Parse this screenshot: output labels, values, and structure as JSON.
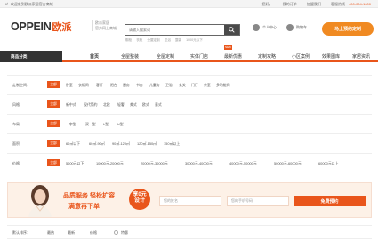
{
  "topbar": {
    "welcome": "Hi！欢迎来到欧派家居官方商城",
    "login": "您好，",
    "myorder": "我的订单",
    "join": "加盟我们",
    "hotline_label": "客服热线",
    "hotline": "400-004-1000"
  },
  "header": {
    "logo_en": "OPPEIN",
    "logo_cn": "欧派",
    "sub1": "欧派家居",
    "sub2": "官方网上商城",
    "search_placeholder": "请输入搜索词",
    "hotwords": [
      "橱柜",
      "衣柜",
      "全屋定制",
      "卫浴",
      "整装",
      "1000元以下"
    ],
    "user_label": "个人中心",
    "cart_label": "购物车",
    "book_button": "马上预约定制"
  },
  "nav": {
    "category": "商品分类",
    "items": [
      "首页",
      "全屋整装",
      "全屋定制",
      "实体门店",
      "最新优惠",
      "定制攻略",
      "小区案例",
      "效果图库",
      "家居资讯"
    ],
    "new_badge": "NEW"
  },
  "filters": [
    {
      "label": "定制空间：",
      "all": "全部",
      "options": [
        "卧室",
        "衣帽间",
        "客厅",
        "阳台",
        "厨房",
        "书房",
        "儿童房",
        "卫浴",
        "玄关",
        "门厅",
        "茶室",
        "多功能间"
      ]
    },
    {
      "label": "风格",
      "all": "全部",
      "options": [
        "新中式",
        "现代简约",
        "北欧",
        "轻奢",
        "美式",
        "欧式",
        "意式"
      ]
    },
    {
      "label": "布局",
      "all": "全部",
      "options": [
        "一字型",
        "双一型",
        "L型",
        "U型"
      ]
    },
    {
      "label": "面积",
      "all": "全部",
      "options": [
        "60㎡以下",
        "60㎡-90㎡",
        "90㎡-120㎡",
        "120㎡-150㎡",
        "150㎡以上"
      ]
    },
    {
      "label": "价格",
      "all": "全部",
      "options": [
        "5000元以下",
        "10000元-20000元",
        "20000元-30000元",
        "30000元-40000元",
        "40000元-50000元",
        "50000元-60000元",
        "60000元以上"
      ]
    }
  ],
  "banner": {
    "slogan1": "品质服务 轻松扩容",
    "slogan2": "满意再下单",
    "badge1": "享0元",
    "badge2": "设计",
    "name_placeholder": "您的姓名",
    "phone_placeholder": "您的手机号码",
    "submit": "免费预约"
  },
  "sort": {
    "label": "默认排序：",
    "options": [
      "最热",
      "最新",
      "价格"
    ],
    "check_label": "特惠"
  },
  "colors": {
    "accent": "#e9551b",
    "book": "#f08a22",
    "dark": "#333333"
  }
}
